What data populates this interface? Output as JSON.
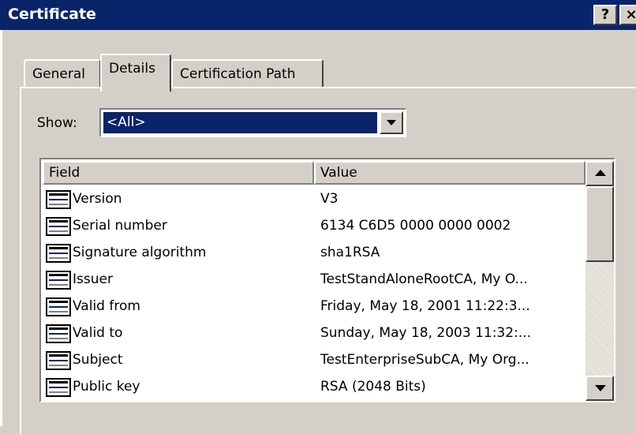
{
  "window": {
    "title": "Certificate",
    "help_glyph": "?",
    "close_glyph": "×",
    "title_bar_color": "#0a246a"
  },
  "tabs": [
    {
      "label": "General",
      "selected": false
    },
    {
      "label": "Details",
      "selected": true
    },
    {
      "label": "Certification Path",
      "selected": false
    }
  ],
  "show": {
    "label": "Show:",
    "value": "<All>"
  },
  "list": {
    "columns": [
      "Field",
      "Value"
    ],
    "rows": [
      {
        "field": "Version",
        "value": "V3",
        "icon": "certificate-field-icon"
      },
      {
        "field": "Serial number",
        "value": "6134 C6D5 0000 0000 0002",
        "icon": "certificate-field-icon"
      },
      {
        "field": "Signature algorithm",
        "value": "sha1RSA",
        "icon": "certificate-field-icon"
      },
      {
        "field": "Issuer",
        "value": "TestStandAloneRootCA, My O...",
        "icon": "certificate-field-icon"
      },
      {
        "field": "Valid from",
        "value": "Friday, May 18, 2001 11:22:3...",
        "icon": "certificate-field-icon"
      },
      {
        "field": "Valid to",
        "value": "Sunday, May 18, 2003 11:32:...",
        "icon": "certificate-field-icon"
      },
      {
        "field": "Subject",
        "value": "TestEnterpriseSubCA, My Org...",
        "icon": "certificate-field-icon"
      },
      {
        "field": "Public key",
        "value": "RSA (2048 Bits)",
        "icon": "certificate-field-icon"
      }
    ]
  }
}
